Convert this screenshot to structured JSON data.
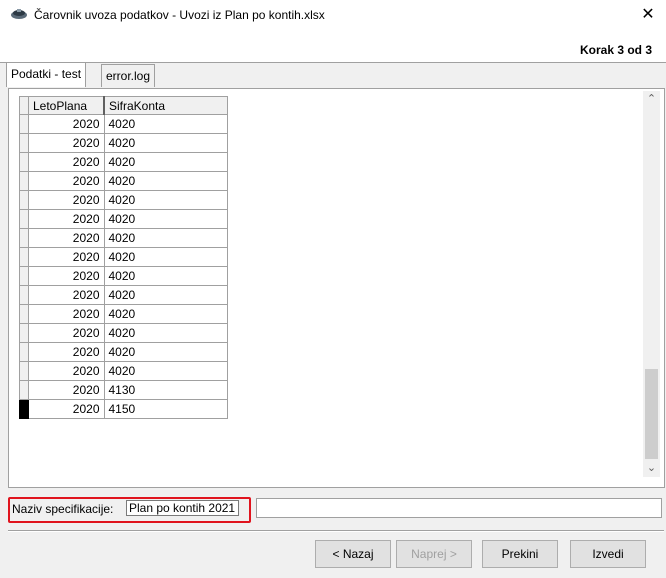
{
  "window": {
    "title": "Čarovnik uvoza podatkov - Uvozi iz Plan po kontih.xlsx",
    "close_label": "✕"
  },
  "header": {
    "step": "Korak 3 od 3"
  },
  "tabs": [
    {
      "label": "Podatki - test",
      "active": true
    },
    {
      "label": "error.log",
      "active": false
    }
  ],
  "grid": {
    "columns": [
      "LetoPlana",
      "SifraKonta"
    ],
    "rows": [
      [
        "2020",
        "4020"
      ],
      [
        "2020",
        "4020"
      ],
      [
        "2020",
        "4020"
      ],
      [
        "2020",
        "4020"
      ],
      [
        "2020",
        "4020"
      ],
      [
        "2020",
        "4020"
      ],
      [
        "2020",
        "4020"
      ],
      [
        "2020",
        "4020"
      ],
      [
        "2020",
        "4020"
      ],
      [
        "2020",
        "4020"
      ],
      [
        "2020",
        "4020"
      ],
      [
        "2020",
        "4020"
      ],
      [
        "2020",
        "4020"
      ],
      [
        "2020",
        "4020"
      ],
      [
        "2020",
        "4130"
      ],
      [
        "2020",
        "4150"
      ]
    ],
    "selected_row": 15
  },
  "spec": {
    "label": "Naziv specifikacije:",
    "value": "Plan po kontih 2021"
  },
  "buttons": {
    "back": "< Nazaj",
    "next": "Naprej >",
    "cancel": "Prekini",
    "execute": "Izvedi"
  }
}
